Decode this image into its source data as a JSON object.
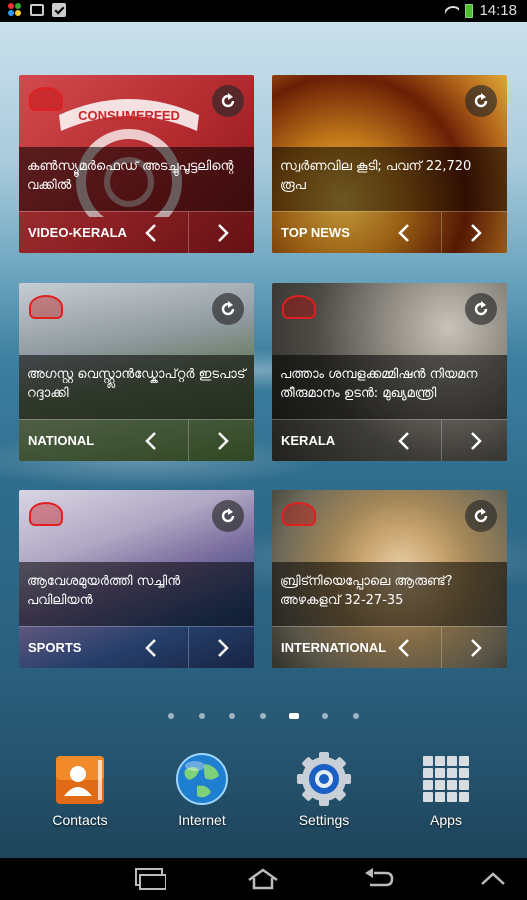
{
  "status_bar": {
    "time": "14:18",
    "left_icons": [
      "apps-dots-icon",
      "bag-icon",
      "clipboard-check-icon"
    ],
    "right_icons": [
      "wifi-icon",
      "battery-icon"
    ]
  },
  "widgets": [
    {
      "headline": "കൺസ്യൂമർഫെഡ് അടച്ചുപൂട്ടലിന്റെ വക്കിൽ",
      "category": "VIDEO-KERALA",
      "logo_text": "CONSUMERFED",
      "colors": {
        "bg1": "#c8373b",
        "bg2": "#8f1f22"
      }
    },
    {
      "headline": "സ്വർണവില കൂടി; പവന് 22,720 രൂപ",
      "category": "TOP NEWS",
      "colors": {
        "bg1": "#c88a1a",
        "bg2": "#7a2a08"
      }
    },
    {
      "headline": "അഗസ്റ്റ വെസ്റ്റ്ലാൻഡ്കോപ്റ്റർ ഇടപാട് റദ്ദാക്കി",
      "category": "NATIONAL",
      "colors": {
        "bg1": "#9aa3a8",
        "bg2": "#4d6a3c"
      }
    },
    {
      "headline": "പത്താം ശമ്പളക്കമ്മിഷൻ നിയമന തീരുമാനം ഉടൻ: മുഖ്യമന്ത്രി",
      "category": "KERALA",
      "colors": {
        "bg1": "#8c8880",
        "bg2": "#3b3a36"
      }
    },
    {
      "headline": "ആവേശമുയർത്തി സച്ചിൻ പവിലിയൻ",
      "category": "SPORTS",
      "colors": {
        "bg1": "#b8b2c8",
        "bg2": "#3e5a8a"
      }
    },
    {
      "headline": "ബ്രിട്നിയെപ്പോലെ ആരുണ്ട്? അഴകളവ് 32-27-35",
      "category": "INTERNATIONAL",
      "colors": {
        "bg1": "#c9b48a",
        "bg2": "#6f6a5a"
      }
    }
  ],
  "pager": {
    "count": 7,
    "active_index": 4
  },
  "dock": [
    {
      "label": "Contacts",
      "icon": "contacts-icon"
    },
    {
      "label": "Internet",
      "icon": "globe-icon"
    },
    {
      "label": "Settings",
      "icon": "gear-icon"
    },
    {
      "label": "Apps",
      "icon": "apps-grid-icon"
    }
  ],
  "nav_bar": [
    "recent-apps-icon",
    "home-icon",
    "back-icon",
    "menu-up-icon"
  ]
}
